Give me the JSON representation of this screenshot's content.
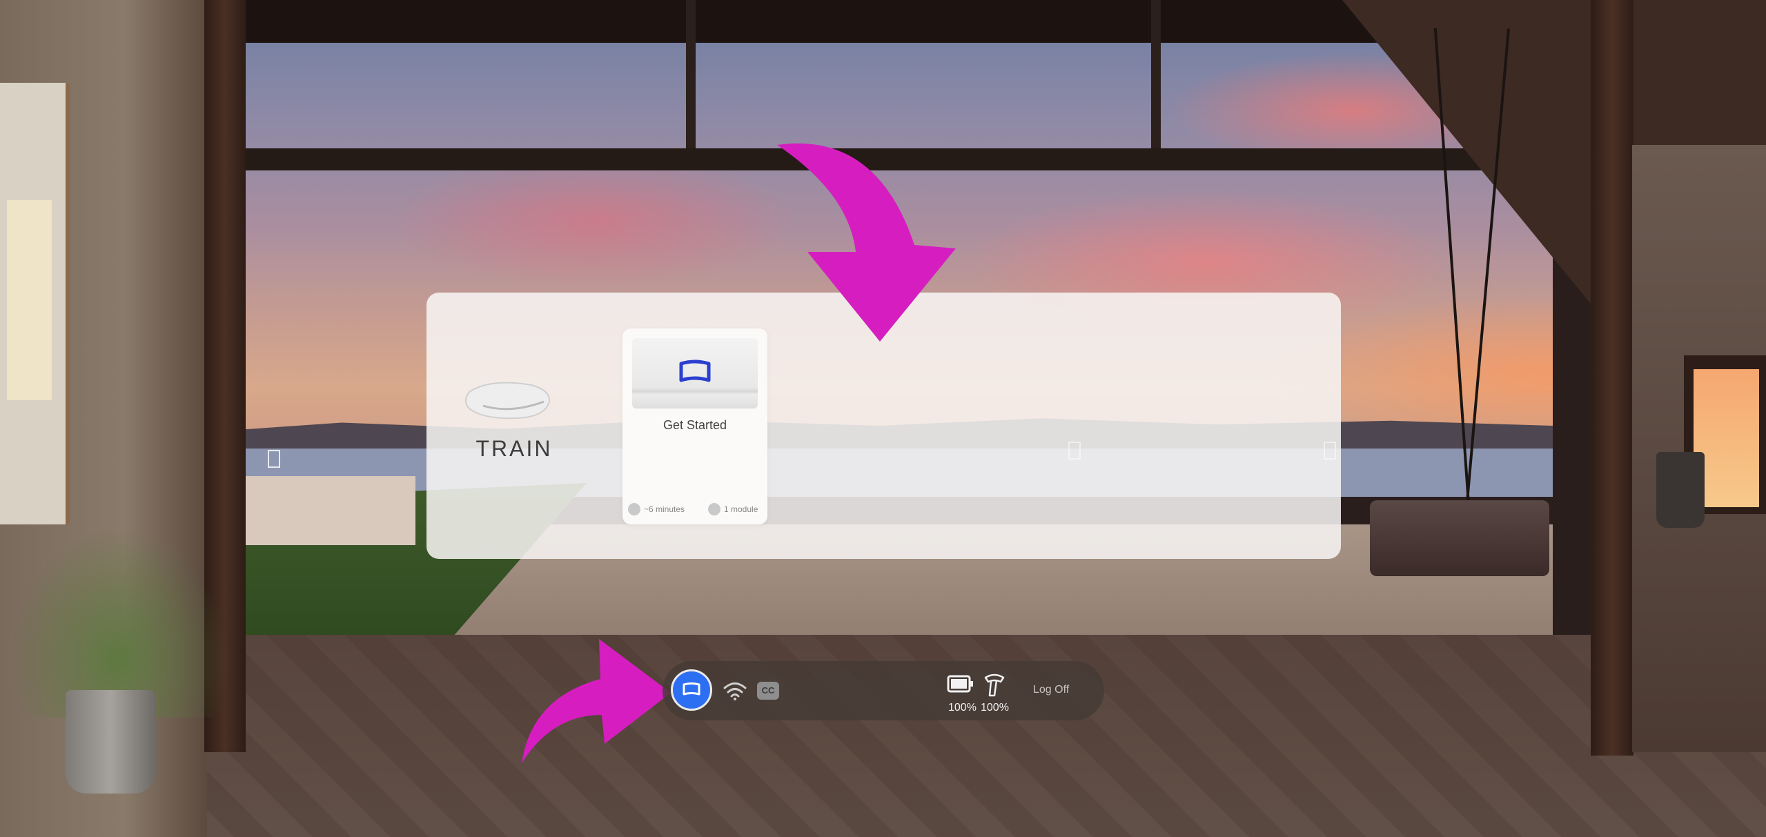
{
  "panel": {
    "app_label": "TRAIN",
    "card": {
      "title": "Get Started",
      "duration": "~6 minutes",
      "modules": "1 module"
    }
  },
  "taskbar": {
    "cc_label": "CC",
    "battery_headset_pct": "100%",
    "battery_controller_pct": "100%",
    "logoff_label": "Log Off"
  },
  "colors": {
    "highlight_arrow": "#d61ec0",
    "home_button": "#2d6ff2",
    "card_icon": "#2a3fd0"
  }
}
